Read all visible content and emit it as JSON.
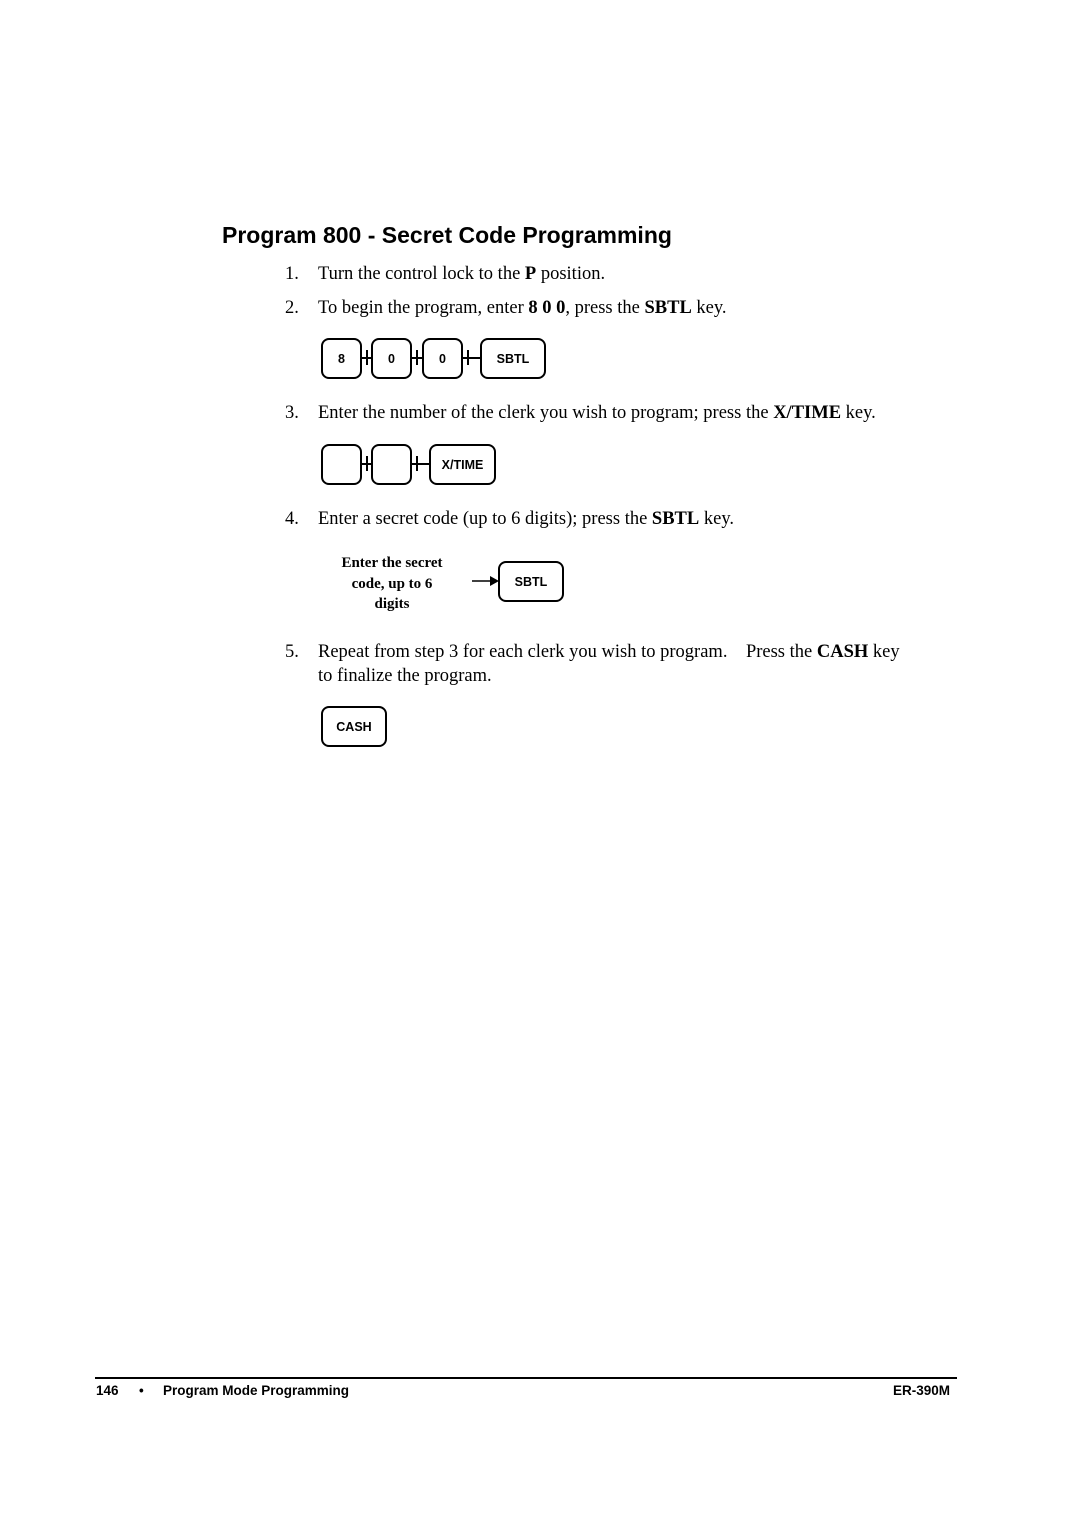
{
  "title": "Program 800 - Secret Code Programming",
  "steps": [
    {
      "number": "1.",
      "parts": {
        "a": "Turn the control lock to the ",
        "b": "P",
        "c": " position."
      }
    },
    {
      "number": "2.",
      "parts": {
        "a": "To begin the program, enter ",
        "b": "8 0 0",
        "c": ", press the ",
        "d": "SBTL",
        "e": " key."
      }
    },
    {
      "number": "3.",
      "parts": {
        "a": "Enter the number of the clerk you wish to program; press the ",
        "b": "X/TIME",
        "c": " key."
      }
    },
    {
      "number": "4.",
      "parts": {
        "a": "Enter a secret code (up to 6 digits); press the ",
        "b": "SBTL",
        "c": " key."
      }
    },
    {
      "number": "5.",
      "parts": {
        "a": "Repeat from step 3 for each clerk you wish to program.    Press the ",
        "b": "CASH",
        "c": " key",
        "line2": "to finalize the program."
      }
    }
  ],
  "diagrams": {
    "step2_keys": [
      "8",
      "0",
      "0",
      "SBTL"
    ],
    "step3_keys": [
      "",
      "",
      "X/TIME"
    ],
    "step4": {
      "caption_lines": [
        "Enter the secret",
        "code, up to 6",
        "digits"
      ],
      "key": "SBTL"
    },
    "step5_keys": [
      "CASH"
    ]
  },
  "footer": {
    "page_number": "146",
    "bullet": "•",
    "section": "Program Mode Programming",
    "model": "ER-390M"
  }
}
